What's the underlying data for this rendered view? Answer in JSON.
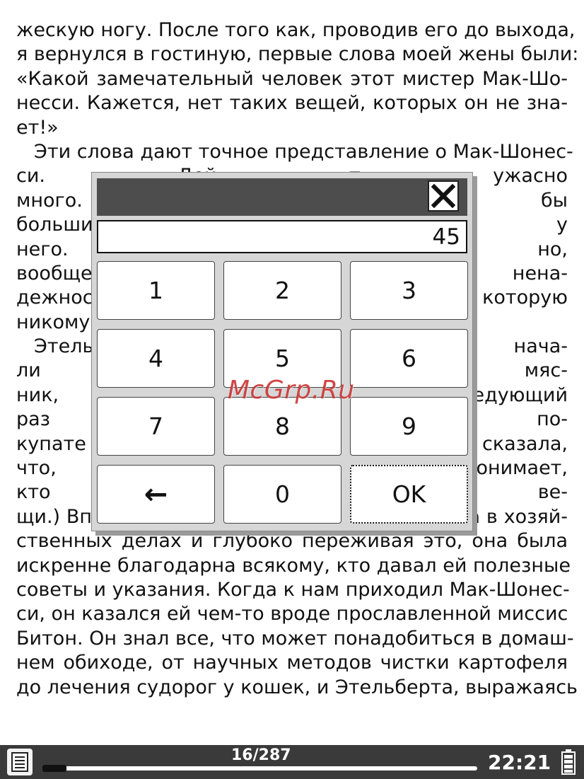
{
  "book": {
    "lines": [
      "жескую ногу. После того как, проводив его до выхода,",
      "я вернулся в гостиную, первые слова моей жены были:",
      "«Какой замечательный человек этот мистер Мак-Шо-",
      "несси. Кажется, нет таких вещей, которых он не зна-",
      "ет!»",
      "Эти слова дают точное представление о Мак-Шонес-",
      "си. Дей                                                               т ужасно",
      "много. Я                                                            го был бы",
      "больши                                                             ий, чем у",
      "него. И                                                            ными, но,",
      "вообще                                                           ной нена-",
      "дежнос                                                           которую",
      "никому",
      "Этель                                                                мы нача-",
      "ли само                                                            овый мяс-",
      "ник, наз                                                            едующий",
      "раз яви                                                             шился по-",
      "купате                                                               сказала,",
      "что, мож                                                            онимает,",
      "кто дал                                                              обные ве-",
      "щи.) Вполне естественно, что, не имея опыта в хозяй-",
      "ственных делах и глубоко переживая это, она была",
      "искренне благодарна всякому, кто давал ей полезные",
      "советы и указания. Когда к нам приходил Мак-Шонес-",
      "си, он казался ей чем-то вроде прославленной миссис",
      "Битон. Он знал все, что может понадобиться в домаш-",
      "нем обиходе, от научных методов чистки картофеля",
      "до лечения судорог у кошек, и Этельберта, выражаясь"
    ]
  },
  "watermark": "McGrp.Ru",
  "dialog": {
    "display_value": "45",
    "keys": [
      "1",
      "2",
      "3",
      "4",
      "5",
      "6",
      "7",
      "8",
      "9",
      "←",
      "0",
      "OK"
    ]
  },
  "statusbar": {
    "page": "16/287",
    "progress": 0.056,
    "time": "22:21"
  }
}
